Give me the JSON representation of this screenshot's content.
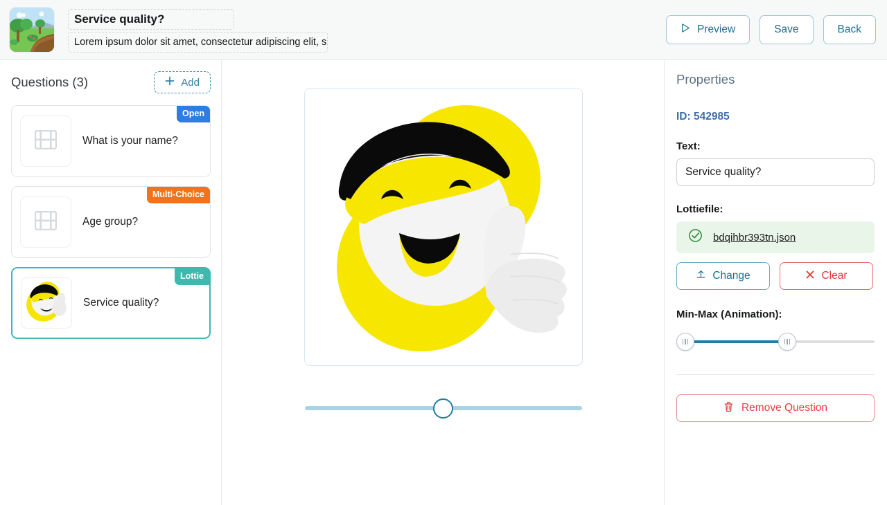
{
  "header": {
    "thumbnail_icon": "park-landscape-thumbnail",
    "title_value": "Service quality?",
    "subtitle_value": "Lorem ipsum dolor sit amet, consectetur adipiscing elit, s",
    "preview_label": "Preview",
    "save_label": "Save",
    "back_label": "Back",
    "preview_icon": "play-triangle-icon"
  },
  "sidebar": {
    "title": "Questions (3)",
    "add_label": "Add",
    "add_icon": "plus-icon",
    "questions": [
      {
        "label": "What is your name?",
        "badge": "Open",
        "badge_color": "#2f7de1",
        "thumb": "film-strip-icon",
        "selected": false
      },
      {
        "label": "Age group?",
        "badge": "Multi-Choice",
        "badge_color": "#f2731c",
        "thumb": "film-strip-icon",
        "selected": false
      },
      {
        "label": "Service quality?",
        "badge": "Lottie",
        "badge_color": "#3fb8ae",
        "thumb": "lottie-smiley-icon",
        "selected": true
      }
    ]
  },
  "preview": {
    "animation_name": "smiley-thumbs-up-lottie",
    "scrubber_value": 50
  },
  "properties": {
    "heading": "Properties",
    "id_label": "ID:",
    "id_value": "542985",
    "text_label": "Text:",
    "text_value": "Service quality?",
    "lottiefile_label": "Lottiefile:",
    "file_name": "bdqihbr393tn.json",
    "file_status_icon": "check-circle-icon",
    "change_label": "Change",
    "change_icon": "upload-icon",
    "clear_label": "Clear",
    "clear_icon": "close-x-icon",
    "minmax_label": "Min-Max (Animation):",
    "min_value": 0,
    "max_value": 52,
    "remove_label": "Remove Question",
    "remove_icon": "trash-icon"
  },
  "colors": {
    "accent_teal": "#3fb8ae",
    "accent_blue": "#1b6e91",
    "danger_red": "#ea3b3b",
    "success_green": "#2f8b3f"
  }
}
